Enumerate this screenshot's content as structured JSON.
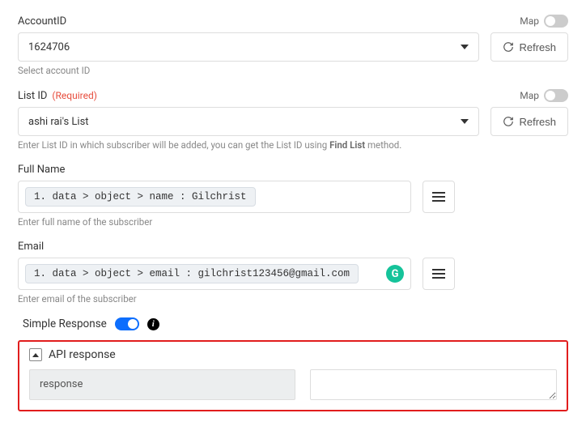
{
  "accountId": {
    "label": "AccountID",
    "mapLabel": "Map",
    "value": "1624706",
    "helper": "Select account ID",
    "refresh": "Refresh"
  },
  "listId": {
    "label": "List ID",
    "requiredText": "(Required)",
    "mapLabel": "Map",
    "value": "ashi rai's List",
    "helperPrefix": "Enter List ID in which subscriber will be added, you can get the List ID using ",
    "helperBold": "Find List",
    "helperSuffix": " method.",
    "refresh": "Refresh"
  },
  "fullName": {
    "label": "Full Name",
    "pill": "1. data > object > name : Gilchrist",
    "helper": "Enter full name of the subscriber"
  },
  "email": {
    "label": "Email",
    "pill": "1. data > object > email : gilchrist123456@gmail.com",
    "badge": "G",
    "helper": "Enter email of the subscriber"
  },
  "simpleResponse": {
    "label": "Simple Response",
    "info": "i"
  },
  "apiResponse": {
    "title": "API response",
    "leftValue": "response"
  }
}
